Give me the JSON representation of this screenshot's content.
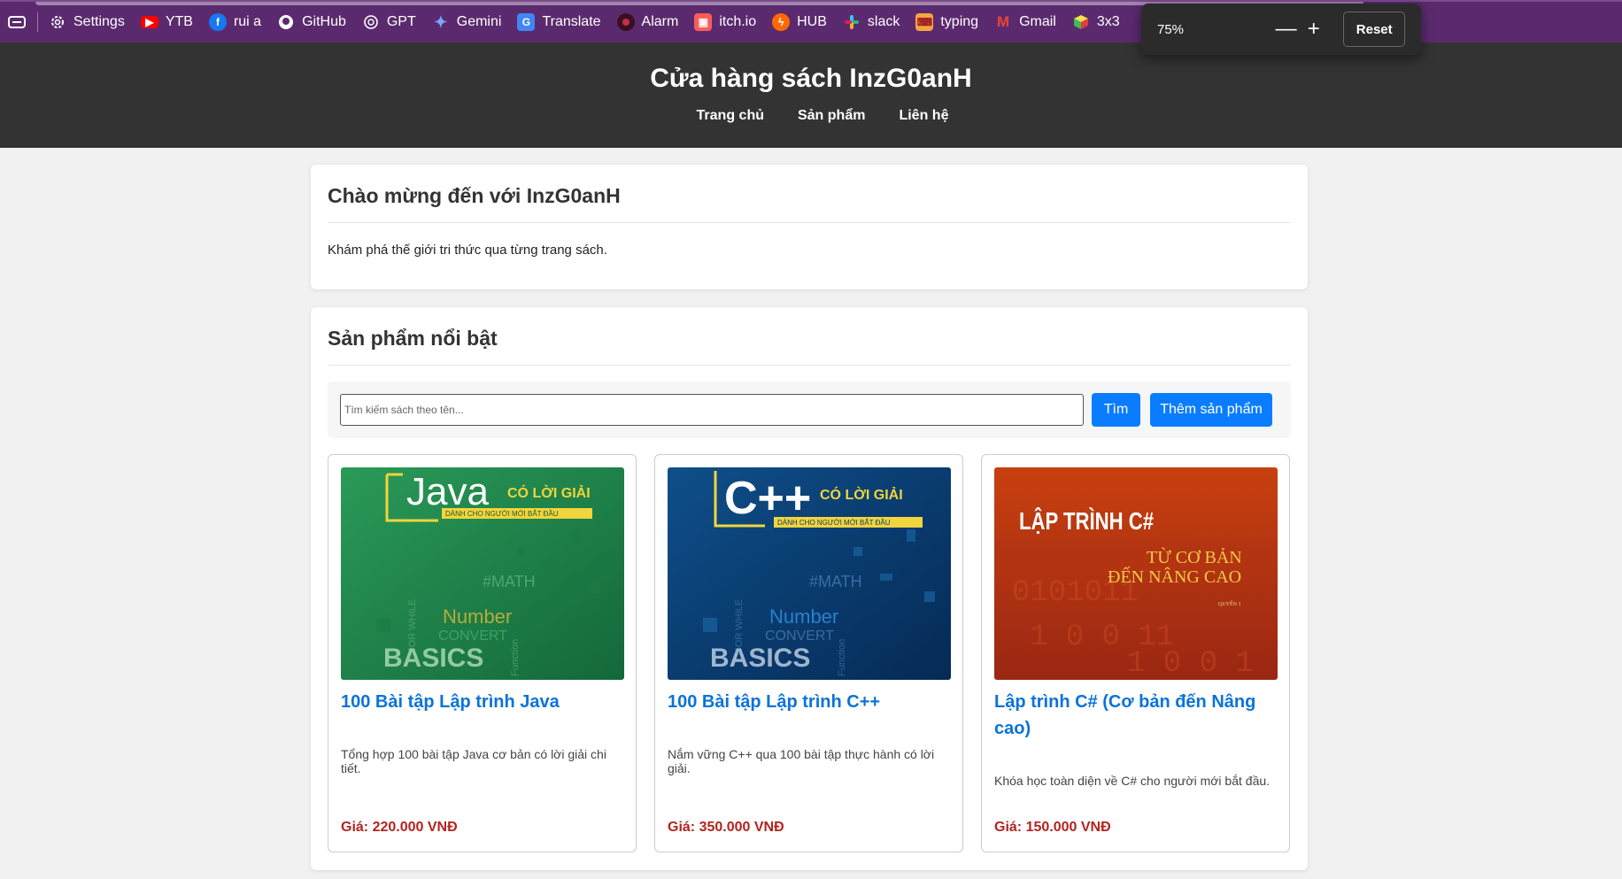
{
  "browser": {
    "bookmarks": [
      {
        "label": "Settings",
        "icon": "gear-icon"
      },
      {
        "label": "YTB",
        "icon": "youtube-icon"
      },
      {
        "label": "rui a",
        "icon": "facebook-icon"
      },
      {
        "label": "GitHub",
        "icon": "github-icon"
      },
      {
        "label": "GPT",
        "icon": "chatgpt-icon"
      },
      {
        "label": "Gemini",
        "icon": "gemini-icon"
      },
      {
        "label": "Translate",
        "icon": "translate-icon"
      },
      {
        "label": "Alarm",
        "icon": "alarm-icon"
      },
      {
        "label": "itch.io",
        "icon": "itchio-icon"
      },
      {
        "label": "HUB",
        "icon": "hub-icon"
      },
      {
        "label": "slack",
        "icon": "slack-icon"
      },
      {
        "label": "typing",
        "icon": "typing-icon"
      },
      {
        "label": "Gmail",
        "icon": "gmail-icon"
      },
      {
        "label": "3x3",
        "icon": "cube-icon"
      }
    ],
    "zoom": {
      "value": "75%",
      "minus": "—",
      "plus": "+",
      "reset_label": "Reset"
    }
  },
  "site": {
    "title": "Cửa hàng sách InzG0anH",
    "nav": [
      "Trang chủ",
      "Sản phẩm",
      "Liên hệ"
    ]
  },
  "welcome": {
    "title": "Chào mừng đến với InzG0anH",
    "text": "Khám phá thế giới tri thức qua từng trang sách."
  },
  "products": {
    "title": "Sản phẩm nổi bật",
    "search_placeholder": "Tìm kiếm sách theo tên...",
    "search_label": "Tìm",
    "add_label": "Thêm sản phẩm",
    "items": [
      {
        "name": "100 Bài tập Lập trình Java",
        "desc": "Tổng hợp 100 bài tập Java cơ bản có lời giải chi tiết.",
        "price": "Giá: 220.000 VNĐ",
        "cover": {
          "lang": "Java",
          "tag": "CÓ LỜI GIẢI",
          "sub": "DÀNH CHO NGƯỜI MỚI BẮT ĐẦU",
          "basics": "BASICS",
          "words": [
            "#MATH",
            "Number",
            "CONVERT",
            "FOR WHILE",
            "Function"
          ]
        }
      },
      {
        "name": "100 Bài tập Lập trình C++",
        "desc": "Nắm vững C++ qua 100 bài tập thực hành có lời giải.",
        "price": "Giá: 350.000 VNĐ",
        "cover": {
          "lang": "C++",
          "tag": "CÓ LỜI GIẢI",
          "sub": "DÀNH CHO NGƯỜI MỚI BẮT ĐẦU",
          "basics": "BASICS",
          "words": [
            "#MATH",
            "Number",
            "CONVERT",
            "FOR WHILE",
            "Function"
          ]
        }
      },
      {
        "name": "Lập trình C# (Cơ bản đến Nâng cao)",
        "desc": "Khóa học toàn diện về C# cho người mới bắt đầu.",
        "price": "Giá: 150.000 VNĐ",
        "cover": {
          "title": "LẬP TRÌNH C#",
          "line1": "TỪ CƠ BẢN",
          "line2": "ĐẾN NÂNG CAO",
          "vol": "QUYỂN 1"
        }
      }
    ]
  },
  "colors": {
    "header_bg": "#333333",
    "accent_blue": "#0a7cff",
    "link_blue": "#0a73d9",
    "price_red": "#b2241f",
    "browser_bar": "#5b2a6e"
  }
}
